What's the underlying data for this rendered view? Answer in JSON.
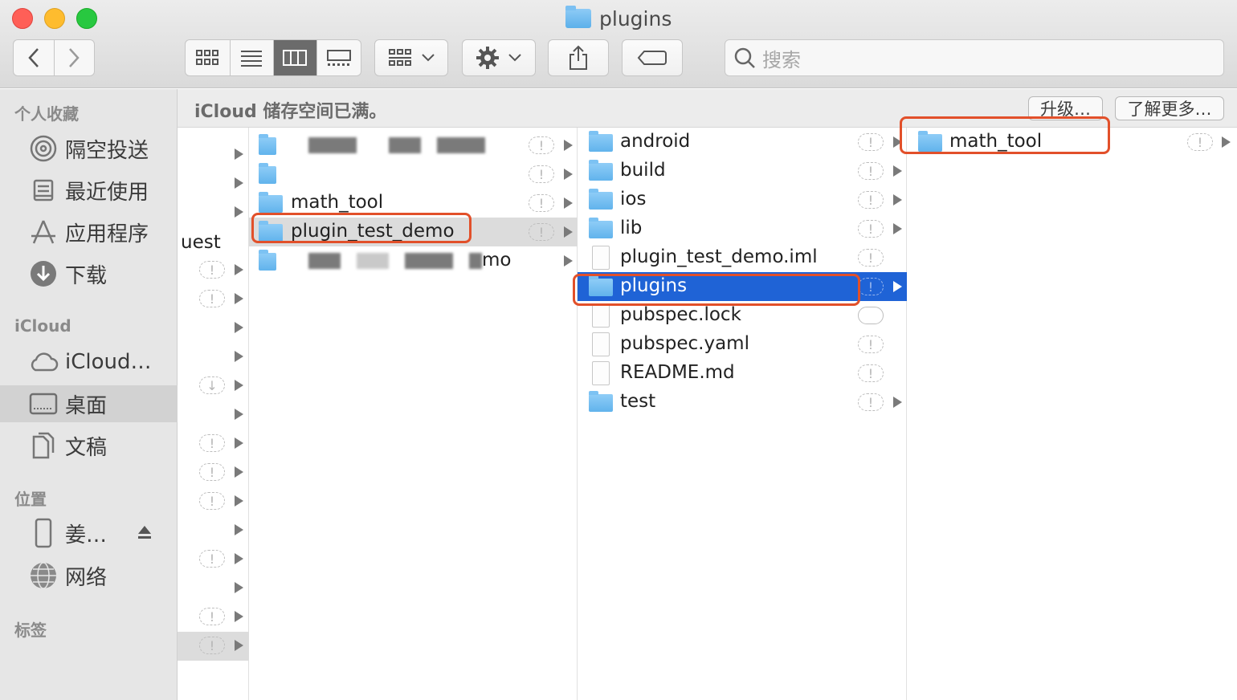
{
  "window": {
    "title": "plugins",
    "title_icon": "folder-icon",
    "traffic_lights": {
      "close": "#ff5f57",
      "minimize": "#febc2e",
      "zoom": "#28c840"
    }
  },
  "toolbar": {
    "back_icon": "chevron-left-icon",
    "forward_icon": "chevron-right-icon",
    "view_modes": [
      "icon-view-icon",
      "list-view-icon",
      "column-view-icon",
      "gallery-view-icon"
    ],
    "active_view": "column-view-icon",
    "group_icon": "group-by-icon",
    "action_icon": "gear-icon",
    "share_icon": "share-icon",
    "tag_icon": "tag-icon",
    "search_placeholder": "搜索"
  },
  "sidebar": {
    "favorites_title": "个人收藏",
    "favorites": [
      {
        "label": "隔空投送",
        "icon": "airdrop-icon"
      },
      {
        "label": "最近使用",
        "icon": "recents-icon"
      },
      {
        "label": "应用程序",
        "icon": "applications-icon"
      },
      {
        "label": "下载",
        "icon": "download-icon"
      }
    ],
    "icloud_title": "iCloud",
    "icloud": [
      {
        "label": "iCloud…",
        "icon": "icloud-icon"
      },
      {
        "label": "桌面",
        "icon": "desktop-icon",
        "selected": true
      },
      {
        "label": "文稿",
        "icon": "documents-icon"
      }
    ],
    "locations_title": "位置",
    "locations": [
      {
        "label": "姜…",
        "icon": "iphone-icon"
      },
      {
        "label": "网络",
        "icon": "network-icon"
      }
    ],
    "tags_title": "标签"
  },
  "banner": {
    "text": "iCloud 储存空间已满。",
    "upgrade": "升级…",
    "learn_more": "了解更多…"
  },
  "column1": {
    "partial_label": "uest"
  },
  "column2": {
    "items": [
      {
        "name": "",
        "blurred": true
      },
      {
        "name": "",
        "blurred": true
      },
      {
        "name": "math_tool"
      },
      {
        "name": "plugin_test_demo",
        "selected": true
      },
      {
        "name": "mo",
        "blurred": true
      }
    ]
  },
  "column3": {
    "items": [
      {
        "name": "android",
        "type": "folder"
      },
      {
        "name": "build",
        "type": "folder"
      },
      {
        "name": "ios",
        "type": "folder"
      },
      {
        "name": "lib",
        "type": "folder"
      },
      {
        "name": "plugin_test_demo.iml",
        "type": "file"
      },
      {
        "name": "plugins",
        "type": "folder",
        "selected": true
      },
      {
        "name": "pubspec.lock",
        "type": "file"
      },
      {
        "name": "pubspec.yaml",
        "type": "file"
      },
      {
        "name": "README.md",
        "type": "file"
      },
      {
        "name": "test",
        "type": "folder"
      }
    ]
  },
  "column4": {
    "items": [
      {
        "name": "math_tool",
        "type": "folder"
      }
    ]
  },
  "annotations": {
    "highlight_color": "#e2502a"
  }
}
